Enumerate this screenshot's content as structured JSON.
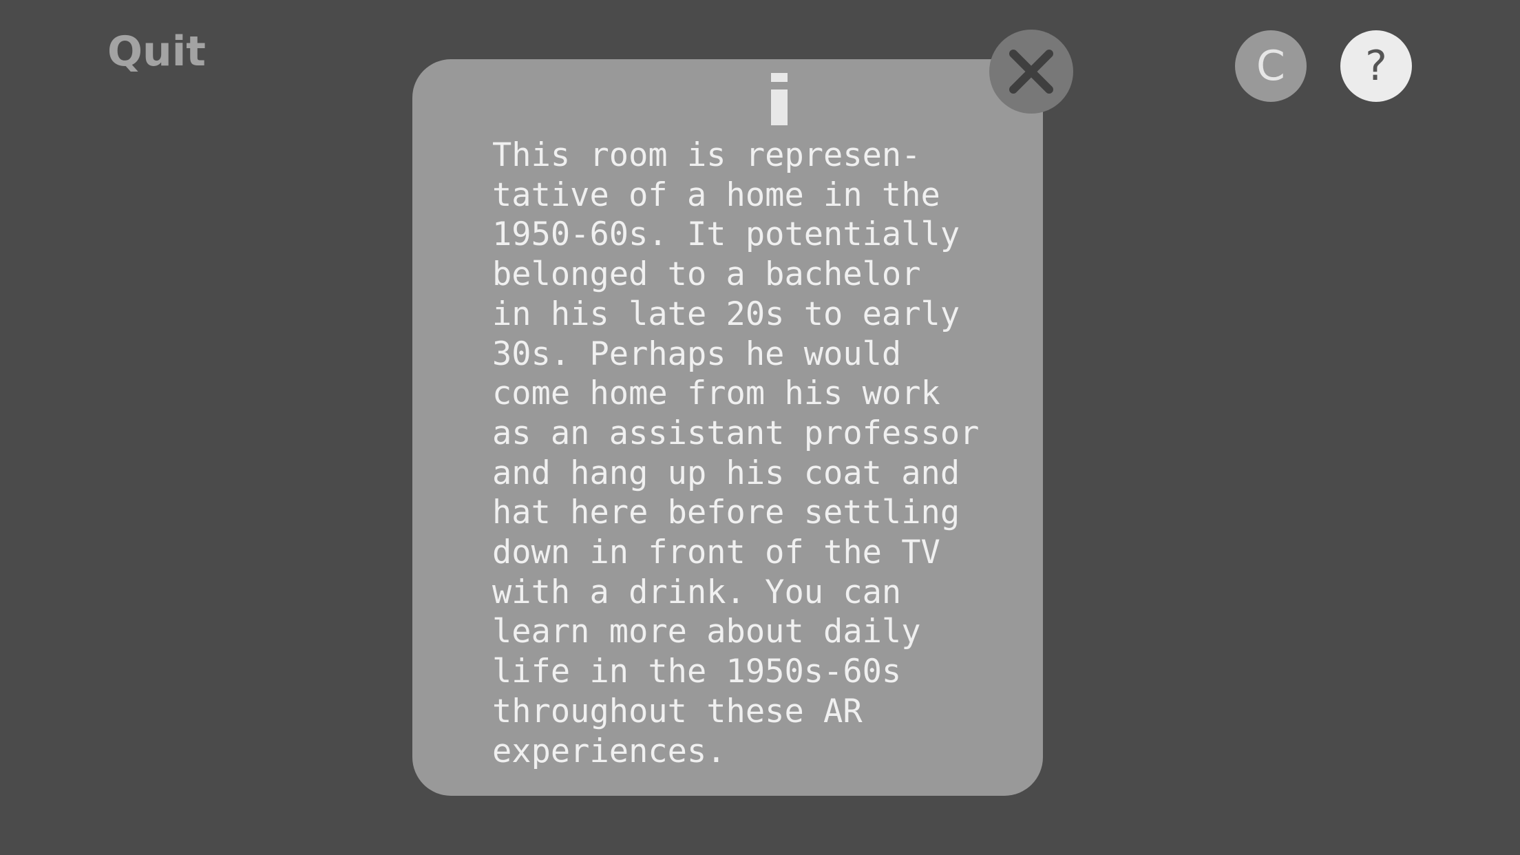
{
  "header": {
    "quit_label": "Quit"
  },
  "controls": {
    "c_label": "C",
    "help_label": "?"
  },
  "info_panel": {
    "icon": "info-icon",
    "close_icon": "close-icon",
    "text": "This room is represen-\ntative of a home in the\n1950-60s. It potentially\nbelonged to a bachelor\nin his late 20s to early\n30s. Perhaps he would\ncome home from his work\nas an assistant professor\nand hang up his coat and\nhat here before settling\ndown in front of the TV\nwith a drink. You can\nlearn more about daily\nlife in the 1950s-60s\nthroughout these AR\nexperiences."
  },
  "colors": {
    "background": "#4b4b4b",
    "panel": "#999999",
    "close_button": "#787878",
    "help_button": "#ececec",
    "text": "#f0f0f0"
  }
}
